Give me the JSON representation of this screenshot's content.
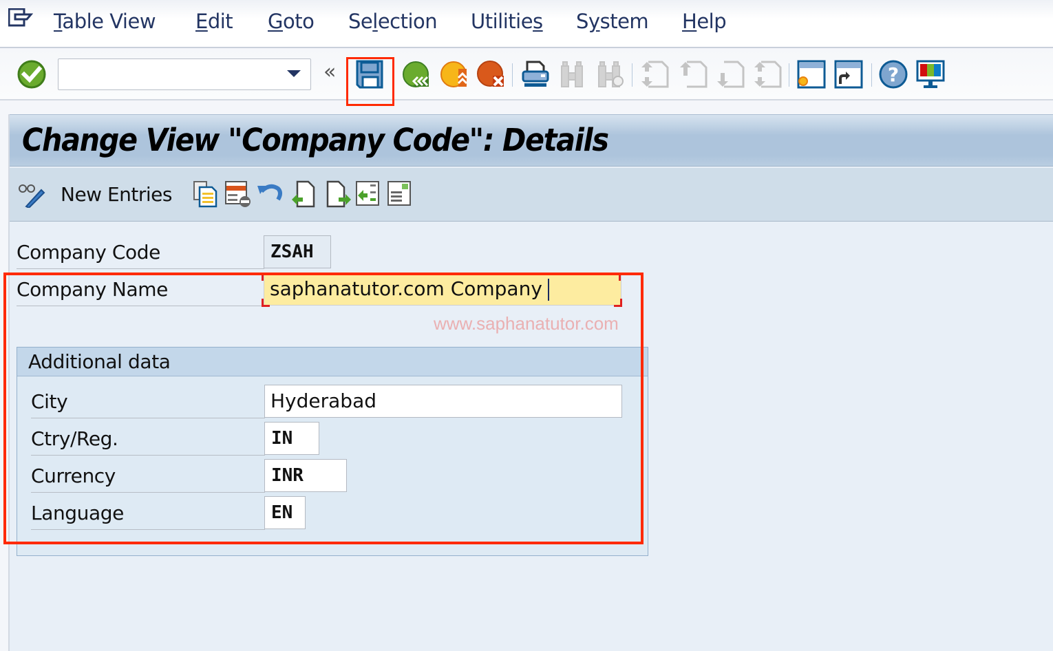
{
  "menubar": {
    "items": [
      {
        "label": "Table View",
        "mnemonic": "T"
      },
      {
        "label": "Edit",
        "mnemonic": "E"
      },
      {
        "label": "Goto",
        "mnemonic": "G"
      },
      {
        "label": "Selection",
        "mnemonic": "l"
      },
      {
        "label": "Utilities",
        "mnemonic": "s"
      },
      {
        "label": "System",
        "mnemonic": "y"
      },
      {
        "label": "Help",
        "mnemonic": "H"
      }
    ]
  },
  "toolbar": {
    "command_field": {
      "value": "",
      "placeholder": ""
    },
    "icons": [
      "enter-icon",
      "collapse-icon",
      "save-icon",
      "back-icon",
      "exit-icon",
      "cancel-icon",
      "print-icon",
      "find-icon",
      "find-next-icon",
      "first-page-icon",
      "previous-page-icon",
      "next-page-icon",
      "last-page-icon",
      "create-session-icon",
      "generate-shortcut-icon",
      "help-icon",
      "customize-layout-icon"
    ],
    "collapse_label": "«"
  },
  "screen": {
    "title": "Change View \"Company Code\": Details",
    "app_toolbar": {
      "new_entries_label": "New Entries",
      "icons": [
        "display-change-icon",
        "copy-as-icon",
        "delete-icon",
        "undo-change-icon",
        "previous-entry-icon",
        "next-entry-icon",
        "select-all-icon",
        "print-standard-list-icon"
      ]
    },
    "fields": {
      "company_code": {
        "label": "Company Code",
        "value": "ZSAH"
      },
      "company_name": {
        "label": "Company Name",
        "value": "saphanatutor.com Company"
      }
    },
    "watermark": "www.saphanatutor.com",
    "additional_data": {
      "title": "Additional data",
      "city": {
        "label": "City",
        "value": "Hyderabad"
      },
      "country": {
        "label": "Ctry/Reg.",
        "value": "IN"
      },
      "currency": {
        "label": "Currency",
        "value": "INR"
      },
      "language": {
        "label": "Language",
        "value": "EN"
      }
    }
  },
  "colors": {
    "highlight": "#ff2a00",
    "title_bar": "#adc4dc",
    "active_field": "#fdeca0",
    "menu_text": "#233563"
  }
}
